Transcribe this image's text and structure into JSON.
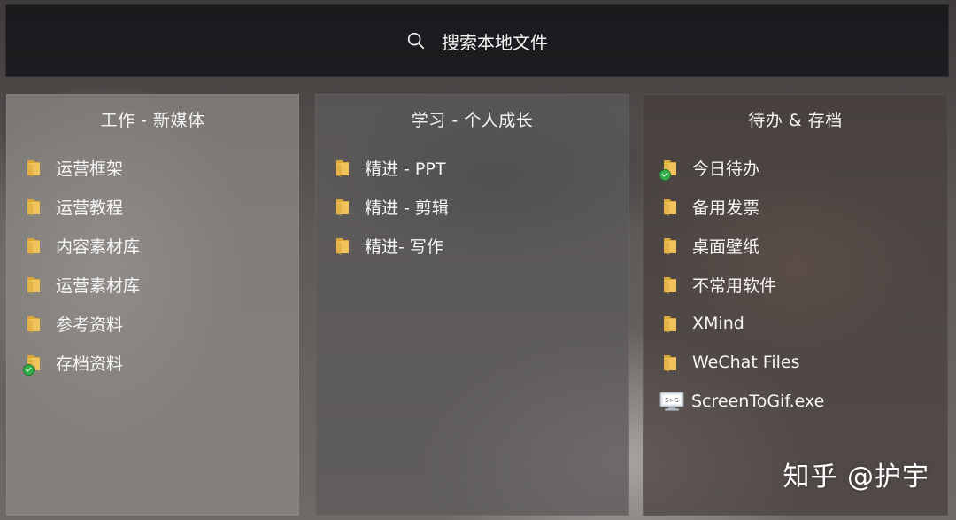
{
  "search": {
    "label": "搜索本地文件",
    "icon": "search-icon"
  },
  "panels": [
    {
      "title": "工作 - 新媒体",
      "items": [
        {
          "label": "运营框架",
          "icon": "folder-icon",
          "synced": false
        },
        {
          "label": "运营教程",
          "icon": "folder-icon",
          "synced": false
        },
        {
          "label": "内容素材库",
          "icon": "folder-icon",
          "synced": false
        },
        {
          "label": "运营素材库",
          "icon": "folder-icon",
          "synced": false
        },
        {
          "label": "参考资料",
          "icon": "folder-icon",
          "synced": false
        },
        {
          "label": "存档资料",
          "icon": "folder-icon",
          "synced": true
        }
      ]
    },
    {
      "title": "学习 - 个人成长",
      "items": [
        {
          "label": "精进 - PPT",
          "icon": "folder-icon",
          "synced": false
        },
        {
          "label": "精进 - 剪辑",
          "icon": "folder-icon",
          "synced": false
        },
        {
          "label": "精进- 写作",
          "icon": "folder-icon",
          "synced": false
        }
      ]
    },
    {
      "title": "待办 & 存档",
      "items": [
        {
          "label": "今日待办",
          "icon": "folder-icon",
          "synced": true
        },
        {
          "label": "备用发票",
          "icon": "folder-icon",
          "synced": false
        },
        {
          "label": "桌面壁纸",
          "icon": "folder-icon",
          "synced": false
        },
        {
          "label": "不常用软件",
          "icon": "folder-icon",
          "synced": false
        },
        {
          "label": "XMind",
          "icon": "folder-icon",
          "synced": false
        },
        {
          "label": "WeChat Files",
          "icon": "folder-icon",
          "synced": false
        },
        {
          "label": "ScreenToGif.exe",
          "icon": "exe-icon",
          "synced": false
        }
      ]
    }
  ],
  "watermark": "知乎 @护宇",
  "colors": {
    "folder": "#f0c45a",
    "folder_dark": "#d9a63a",
    "sync_badge": "#34b04a"
  }
}
